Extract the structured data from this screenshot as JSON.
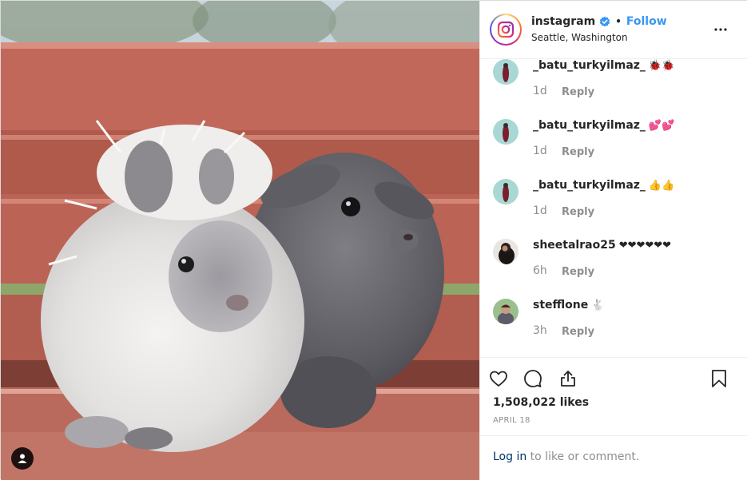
{
  "header": {
    "username": "instagram",
    "separator": "•",
    "follow_label": "Follow",
    "location": "Seattle, Washington",
    "verified_color": "#3897f0"
  },
  "comments": [
    {
      "user": "_batu_turkyilmaz_",
      "text": "🐞🐞",
      "time": "1d",
      "reply": "Reply"
    },
    {
      "user": "_batu_turkyilmaz_",
      "text": "💕💕",
      "time": "1d",
      "reply": "Reply"
    },
    {
      "user": "_batu_turkyilmaz_",
      "text": "👍👍",
      "time": "1d",
      "reply": "Reply"
    },
    {
      "user": "sheetalrao25",
      "text": "❤❤❤❤❤❤",
      "time": "6h",
      "reply": "Reply"
    },
    {
      "user": "stefflone",
      "text": "🐇",
      "time": "3h",
      "reply": "Reply"
    }
  ],
  "post": {
    "likes": "1,508,022 likes",
    "date": "APRIL 18"
  },
  "login": {
    "link": "Log in",
    "rest": " to like or comment."
  },
  "colors": {
    "accent": "#3897f0",
    "link_dark": "#003569",
    "muted": "#8e8e8e",
    "text": "#262626"
  },
  "icons": [
    "instagram-logo-icon",
    "verified-badge-icon",
    "more-options-icon",
    "heart-icon",
    "comment-icon",
    "share-icon",
    "bookmark-icon",
    "user-tag-icon"
  ]
}
